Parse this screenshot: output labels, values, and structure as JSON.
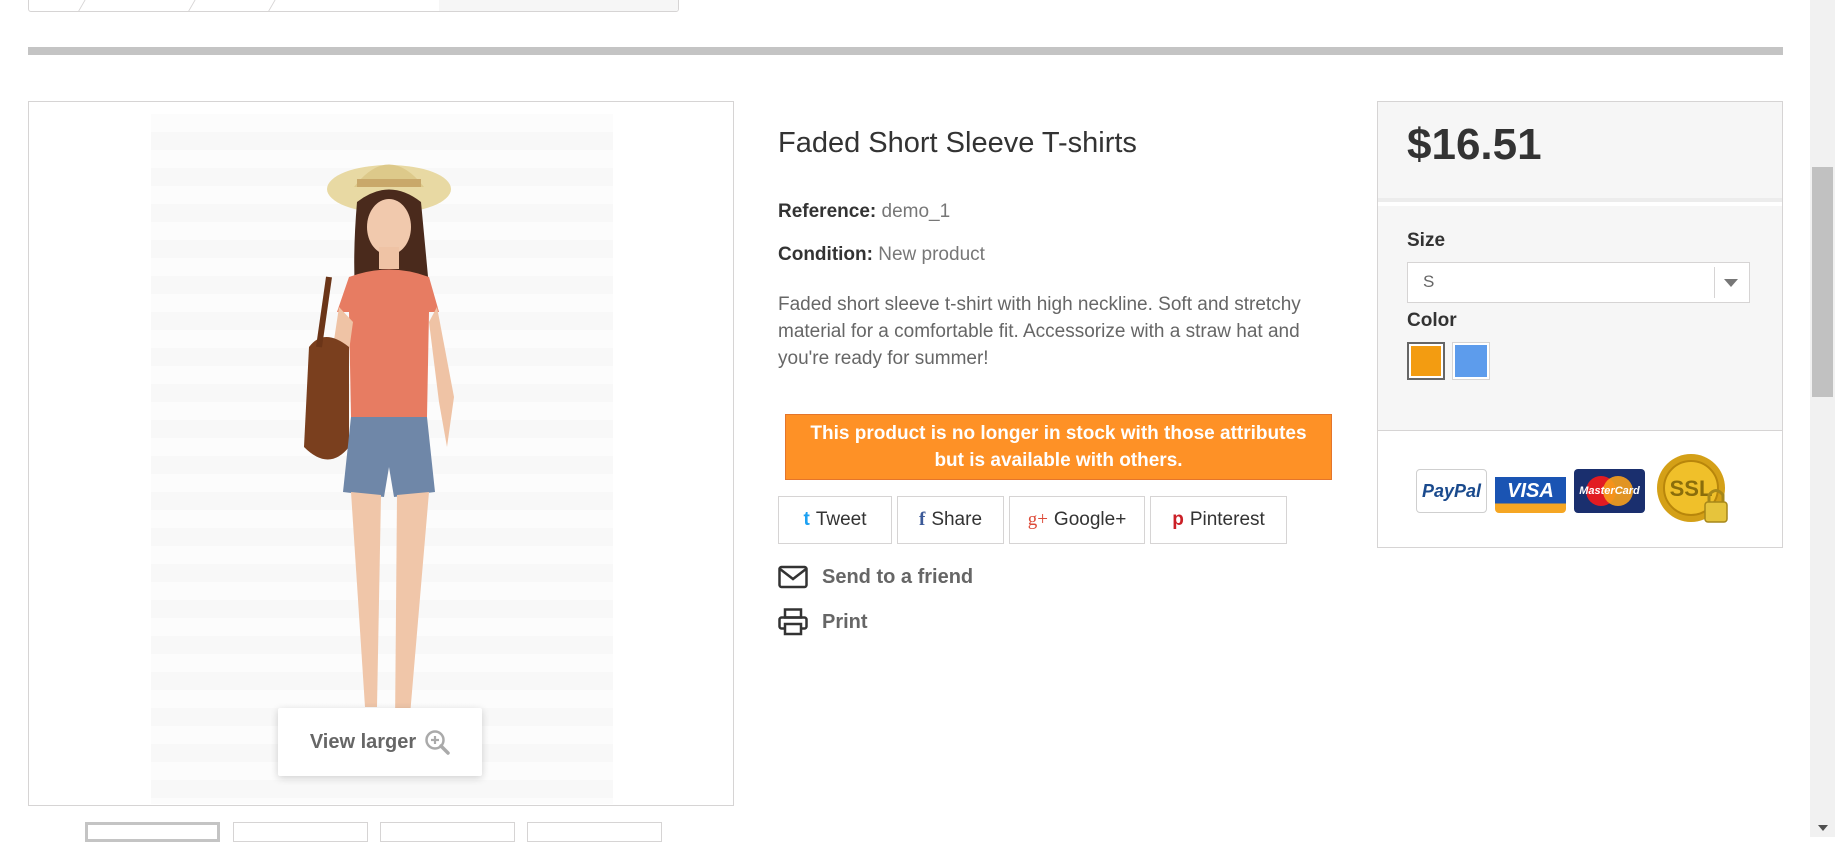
{
  "product": {
    "title": "Faded Short Sleeve T-shirts",
    "reference_label": "Reference:",
    "reference_value": "demo_1",
    "condition_label": "Condition:",
    "condition_value": "New product",
    "description_line1": "Faded short sleeve t-shirt with high neckline. Soft and stretchy",
    "description_line2": "material for a comfortable fit. Accessorize with a straw hat and",
    "description_line3": "you're ready for summer!",
    "stock_warning_line1": "This product is no longer in stock with those attributes",
    "stock_warning_line2": "but is available with others."
  },
  "image": {
    "view_larger_label": "View larger",
    "zoom_icon": "zoom-in-icon"
  },
  "share": {
    "tweet": "Tweet",
    "share": "Share",
    "google": "Google+",
    "pinterest": "Pinterest",
    "tweet_icon_glyph": "t",
    "facebook_icon_glyph": "f",
    "google_icon_glyph": "g+",
    "pinterest_icon_glyph": "p"
  },
  "actions": {
    "send_to_friend": "Send to a friend",
    "print": "Print"
  },
  "buybox": {
    "price": "$16.51",
    "size_label": "Size",
    "size_selected": "S",
    "color_label": "Color",
    "colors": [
      "#f39c11",
      "#5d9cec"
    ],
    "selected_color_index": 0,
    "payment_logos": {
      "paypal": "PayPal",
      "visa": "VISA",
      "mastercard": "MasterCard",
      "ssl": "SSL"
    }
  },
  "colors": {
    "warning_bg": "#fe9126",
    "price_area_bg": "#f6f6f6",
    "twitter": "#1da1f2",
    "facebook": "#3b5998",
    "google": "#dd4b39",
    "pinterest": "#cb2027"
  }
}
